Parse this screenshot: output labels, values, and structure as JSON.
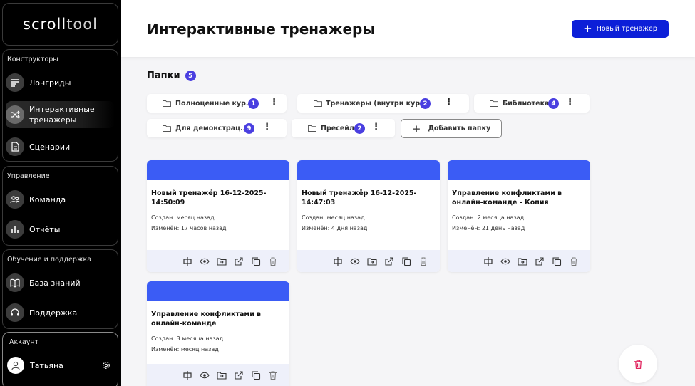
{
  "sidebar": {
    "logo": {
      "part1": "scroll",
      "part2": "tool"
    },
    "sections": [
      {
        "title": "Конструкторы",
        "items": [
          {
            "label": "Лонгриды",
            "icon": "lines-icon"
          },
          {
            "label": "Интерактивные тренажеры",
            "icon": "shuffle-icon",
            "active": true
          },
          {
            "label": "Сценарии",
            "icon": "document-icon"
          }
        ]
      },
      {
        "title": "Управление",
        "items": [
          {
            "label": "Команда",
            "icon": "team-icon"
          },
          {
            "label": "Отчёты",
            "icon": "bar-chart-icon"
          }
        ]
      },
      {
        "title": "Обучение и поддержка",
        "items": [
          {
            "label": "База знаний",
            "icon": "book-icon"
          },
          {
            "label": "Поддержка",
            "icon": "headset-icon"
          }
        ]
      }
    ],
    "account": {
      "title": "Аккаунт",
      "user": "Татьяна"
    }
  },
  "header": {
    "title": "Интерактивные тренажеры",
    "new_button": "Новый тренажер"
  },
  "folders": {
    "title": "Папки",
    "count": "5",
    "items": [
      {
        "label": "Полноценные кур...",
        "count": "1"
      },
      {
        "label": "Тренажеры (внутри кур...",
        "count": "2"
      },
      {
        "label": "Библиотека",
        "count": "4"
      },
      {
        "label": "Для демонстрац...",
        "count": "9"
      },
      {
        "label": "Пресейл",
        "count": "2"
      }
    ],
    "add_label": "Добавить папку"
  },
  "cards": [
    {
      "title": "Новый тренажёр 16-12-2025-14:50:09",
      "created": "Создан: месяц назад",
      "modified": "Изменён: 17 часов назад"
    },
    {
      "title": "Новый тренажёр 16-12-2025-14:47:03",
      "created": "Создан: месяц назад",
      "modified": "Изменён: 4 дня назад"
    },
    {
      "title": "Управление конфликтами в онлайн-команде - Копия",
      "created": "Создан: 2 месяца назад",
      "modified": "Изменён: 21 день назад"
    },
    {
      "title": "Управление конфликтами в онлайн-команде",
      "created": "Создан: 3 месяца назад",
      "modified": "Изменён: месяц назад"
    }
  ],
  "colors": {
    "accent": "#0c1fd8",
    "card_header": "#3b5cf5",
    "badge": "#4a3fe0",
    "danger": "#e0245e"
  }
}
